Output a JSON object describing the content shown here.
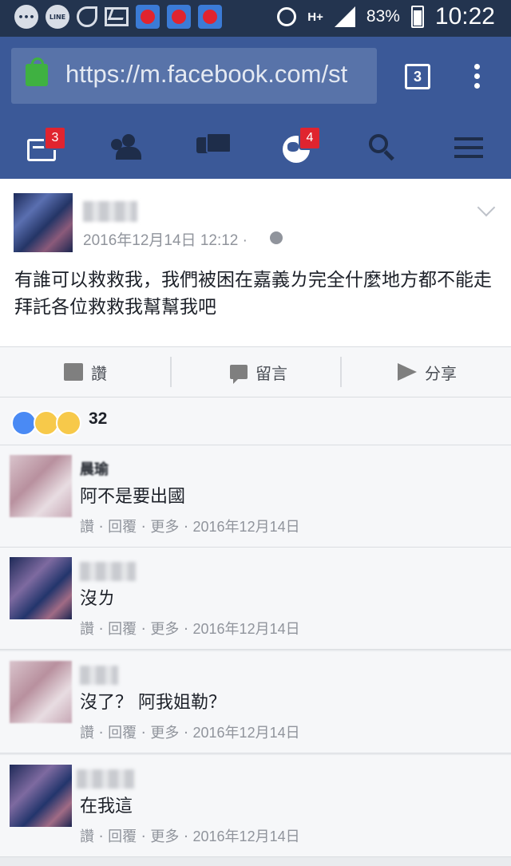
{
  "status_bar": {
    "time": "10:22",
    "battery": "83%",
    "network": "H+",
    "line_label": "LINE",
    "icons": [
      "chat-bubble-icon",
      "line-icon",
      "satellite-icon",
      "gmail-icon",
      "app-icon",
      "app-icon",
      "app-icon",
      "alarm-icon",
      "network-icon",
      "signal-icon",
      "battery-icon"
    ]
  },
  "browser": {
    "url": "https://m.facebook.com/st",
    "tab_count": "3"
  },
  "fb_nav": {
    "items": [
      {
        "icon": "news-feed-icon",
        "badge": "3"
      },
      {
        "icon": "friends-icon",
        "badge": ""
      },
      {
        "icon": "messages-icon",
        "badge": ""
      },
      {
        "icon": "notifications-globe-icon",
        "badge": "4"
      },
      {
        "icon": "search-icon",
        "badge": ""
      },
      {
        "icon": "menu-icon",
        "badge": ""
      }
    ]
  },
  "post": {
    "timestamp": "2016年12月14日 12:12 ·",
    "text": "有誰可以救救我，我們被困在嘉義ㄌ完全什麼地方都不能走拜託各位救救我幫幫我吧"
  },
  "actions": {
    "like": "讚",
    "comment": "留言",
    "share": "分享"
  },
  "reactions": {
    "count": "32",
    "types": [
      "like",
      "wow",
      "sad"
    ]
  },
  "comments": [
    {
      "name": "晨瑜",
      "text": "阿不是要出國",
      "like": "讚",
      "reply": "回覆",
      "more": "更多",
      "date": "2016年12月14日"
    },
    {
      "name": "",
      "text": "沒ㄌ",
      "like": "讚",
      "reply": "回覆",
      "more": "更多",
      "date": "2016年12月14日"
    },
    {
      "name": "",
      "text": "沒了？ 阿我姐勒？",
      "like": "讚",
      "reply": "回覆",
      "more": "更多",
      "date": "2016年12月14日"
    },
    {
      "name": "",
      "text": "在我這",
      "like": "讚",
      "reply": "回覆",
      "more": "更多",
      "date": "2016年12月14日"
    }
  ],
  "colors": {
    "fb_blue": "#3b5998",
    "status_bar": "#23344f",
    "badge_red": "#e0242f",
    "secondary_text": "#90949c"
  }
}
